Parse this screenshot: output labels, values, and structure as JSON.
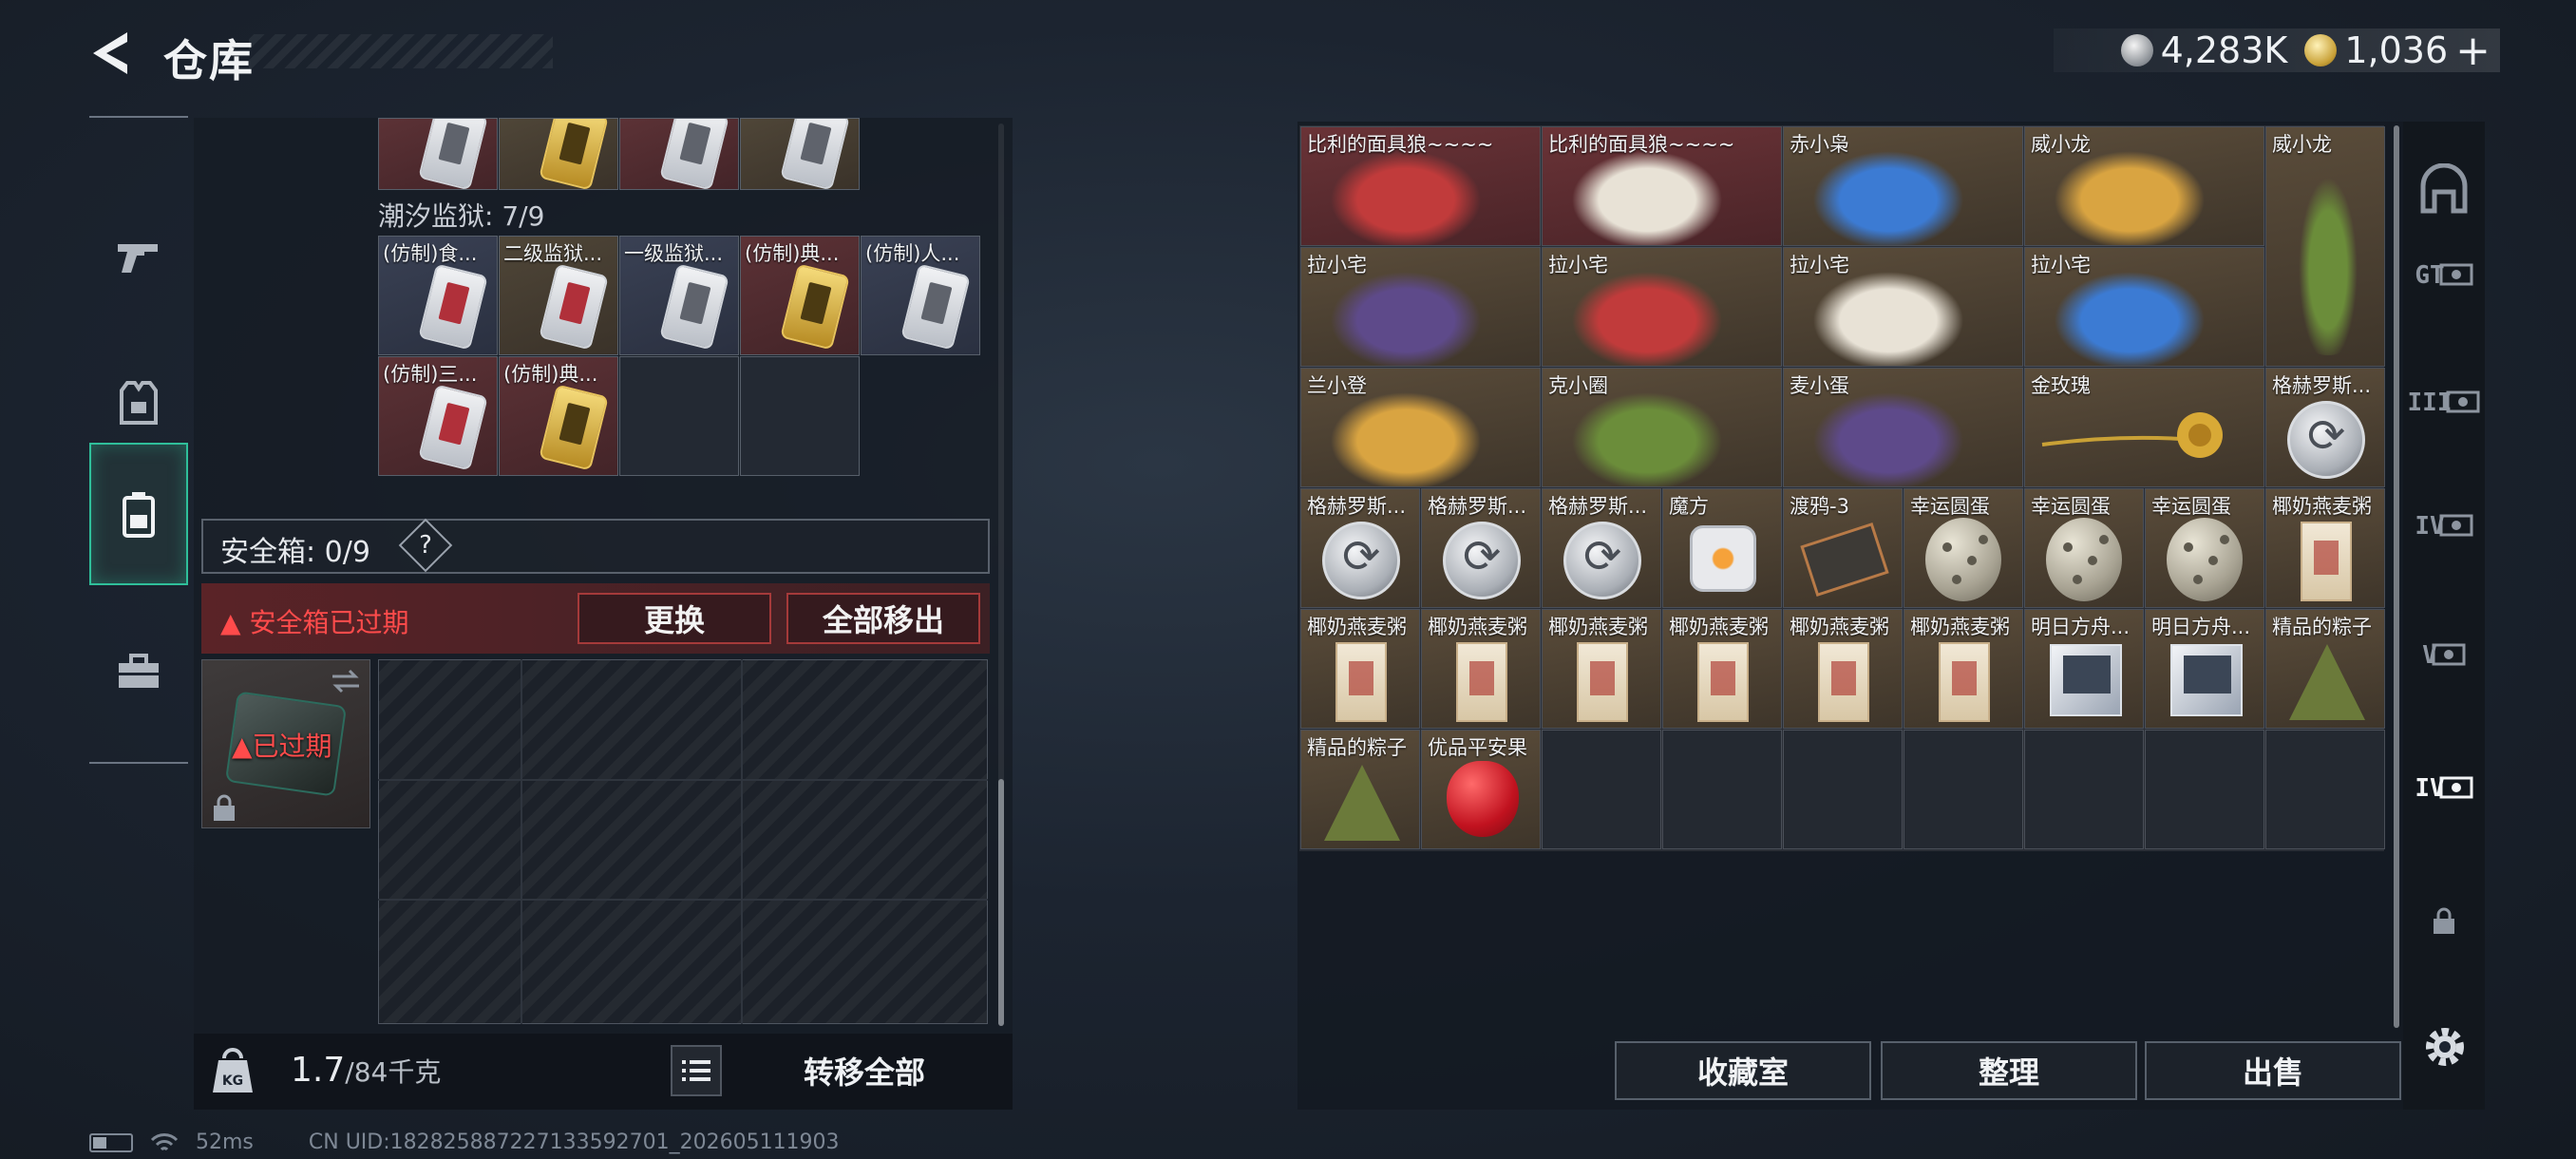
{
  "header": {
    "title": "仓库",
    "currency": [
      {
        "icon": "silver-coin-icon",
        "value": "4,283K"
      },
      {
        "icon": "gold-coin-icon",
        "value": "1,036"
      }
    ],
    "add_label": "+"
  },
  "left_rail": {
    "items": [
      {
        "name": "weapons-tab",
        "icon": "gun-icon",
        "active": false
      },
      {
        "name": "armor-tab",
        "icon": "vest-icon",
        "active": false
      },
      {
        "name": "storage-tab",
        "icon": "backpack-icon",
        "active": true
      },
      {
        "name": "toolbox-tab",
        "icon": "toolbox-icon",
        "active": false
      }
    ]
  },
  "storage": {
    "top_row_items": [
      "",
      "",
      "",
      ""
    ],
    "region_label": "潮汐监狱: 7/9",
    "region_items": [
      {
        "label": "(仿制)食...",
        "tone": "blue",
        "card": "silver-red"
      },
      {
        "label": "二级监狱...",
        "tone": "brown",
        "card": "silver-red"
      },
      {
        "label": "一级监狱...",
        "tone": "blue",
        "card": "silver"
      },
      {
        "label": "(仿制)典...",
        "tone": "red",
        "card": "gold"
      },
      {
        "label": "(仿制)人...",
        "tone": "blue",
        "card": "silver"
      },
      {
        "label": "(仿制)三...",
        "tone": "red",
        "card": "silver-red"
      },
      {
        "label": "(仿制)典...",
        "tone": "red",
        "card": "gold"
      },
      {
        "label": "",
        "tone": "empty"
      },
      {
        "label": "",
        "tone": "empty"
      }
    ]
  },
  "safebox": {
    "label": "安全箱: 0/9",
    "help": "?",
    "expired_warning": "安全箱已过期",
    "swap_label": "更换",
    "remove_all_label": "全部移出",
    "case_status": "已过期"
  },
  "weight": {
    "current": "1.7",
    "max": "/84千克"
  },
  "transfer_all_label": "转移全部",
  "status": {
    "ping": "52ms",
    "uid": "CN UID:1828258872271335927​01_202605111903"
  },
  "collection": {
    "cells": [
      {
        "label": "比利的面具狼~~~~",
        "tone": "red",
        "art": "figure",
        "span": 2
      },
      {
        "label": "比利的面具狼~~~~",
        "tone": "red",
        "art": "figure",
        "span": 2
      },
      {
        "label": "赤小枭",
        "tone": "brown",
        "art": "figure",
        "span": 2
      },
      {
        "label": "威小龙",
        "tone": "brown",
        "art": "figure",
        "span": 2
      },
      {
        "label": "威小龙",
        "tone": "brown",
        "art": "figure-tall",
        "span": 1
      },
      {
        "label": "拉小宅",
        "tone": "brown",
        "art": "figure",
        "span": 2
      },
      {
        "label": "拉小宅",
        "tone": "brown",
        "art": "figure",
        "span": 2
      },
      {
        "label": "拉小宅",
        "tone": "brown",
        "art": "figure",
        "span": 2
      },
      {
        "label": "拉小宅",
        "tone": "brown",
        "art": "figure",
        "span": 2
      },
      {
        "label": "兰小登",
        "tone": "brown",
        "art": "figure",
        "span": 2
      },
      {
        "label": "克小圈",
        "tone": "brown",
        "art": "figure",
        "span": 2
      },
      {
        "label": "麦小蛋",
        "tone": "brown",
        "art": "figure",
        "span": 2
      },
      {
        "label": "金玫瑰",
        "tone": "brown",
        "art": "rose",
        "span": 2
      },
      {
        "label": "格赫罗斯...",
        "tone": "brown",
        "art": "disc",
        "span": 1
      },
      {
        "label": "格赫罗斯...",
        "tone": "brown",
        "art": "disc",
        "span": 1
      },
      {
        "label": "格赫罗斯...",
        "tone": "brown",
        "art": "disc",
        "span": 1
      },
      {
        "label": "格赫罗斯...",
        "tone": "brown",
        "art": "disc",
        "span": 1
      },
      {
        "label": "魔方",
        "tone": "brown",
        "art": "cube",
        "span": 1
      },
      {
        "label": "渡鸦-3",
        "tone": "brown",
        "art": "cassette",
        "span": 1
      },
      {
        "label": "幸运圆蛋",
        "tone": "brown",
        "art": "egg",
        "span": 1
      },
      {
        "label": "幸运圆蛋",
        "tone": "brown",
        "art": "egg",
        "span": 1
      },
      {
        "label": "幸运圆蛋",
        "tone": "brown",
        "art": "egg",
        "span": 1
      },
      {
        "label": "椰奶燕麦粥",
        "tone": "brown",
        "art": "pack",
        "span": 1
      },
      {
        "label": "椰奶燕麦粥",
        "tone": "brown",
        "art": "pack",
        "span": 1
      },
      {
        "label": "椰奶燕麦粥",
        "tone": "brown",
        "art": "pack",
        "span": 1
      },
      {
        "label": "椰奶燕麦粥",
        "tone": "brown",
        "art": "pack",
        "span": 1
      },
      {
        "label": "椰奶燕麦粥",
        "tone": "brown",
        "art": "pack",
        "span": 1
      },
      {
        "label": "椰奶燕麦粥",
        "tone": "brown",
        "art": "pack",
        "span": 1
      },
      {
        "label": "椰奶燕麦粥",
        "tone": "brown",
        "art": "pack",
        "span": 1
      },
      {
        "label": "明日方舟...",
        "tone": "brown",
        "art": "cd",
        "span": 1
      },
      {
        "label": "明日方舟...",
        "tone": "brown",
        "art": "cd",
        "span": 1
      },
      {
        "label": "精品的粽子",
        "tone": "brown",
        "art": "zongzi",
        "span": 1
      },
      {
        "label": "精品的粽子",
        "tone": "brown",
        "art": "zongzi",
        "span": 1
      },
      {
        "label": "优品平安果",
        "tone": "brown",
        "art": "apple",
        "span": 1
      }
    ],
    "collection_room_label": "收藏室",
    "sort_label": "整理",
    "sell_label": "出售"
  },
  "right_rail": {
    "tabs": [
      {
        "name": "home-tab",
        "label": "",
        "active": false
      },
      {
        "name": "tier-gt-tab",
        "label": "GT",
        "active": false
      },
      {
        "name": "tier-3-tab",
        "label": "III",
        "active": false
      },
      {
        "name": "tier-4-tab",
        "label": "IV",
        "active": false
      },
      {
        "name": "tier-5-tab",
        "label": "V",
        "active": false
      },
      {
        "name": "tier-4b-tab",
        "label": "IV",
        "active": true
      },
      {
        "name": "locked-tab",
        "label": "",
        "active": false
      }
    ]
  },
  "colors": {
    "accent": "#2fbf9a",
    "warning": "#ff4b4b",
    "cell_red": "#5c3236",
    "cell_brown": "#4f4638",
    "cell_blue": "#3a4154"
  }
}
